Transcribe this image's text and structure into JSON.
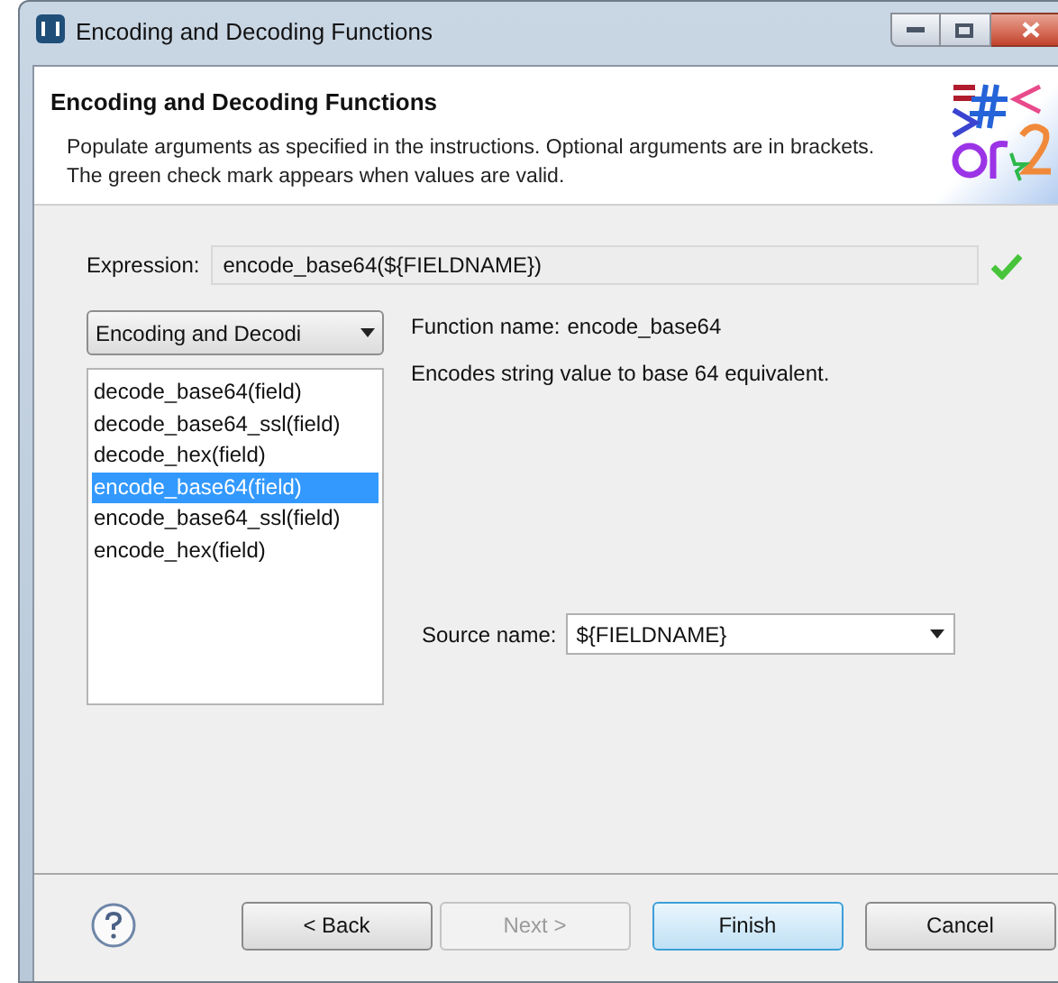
{
  "window": {
    "title": "Encoding and Decoding Functions",
    "controls": [
      {
        "kind": "minimize"
      },
      {
        "kind": "maximize"
      },
      {
        "kind": "close"
      }
    ]
  },
  "header": {
    "title": "Encoding and Decoding Functions",
    "description": "Populate arguments as specified in the instructions. Optional arguments are in brackets. The green check mark appears when values are valid."
  },
  "expression": {
    "label": "Expression:",
    "value": "encode_base64(${FIELDNAME})",
    "valid": true
  },
  "category": {
    "value": "Encoding and Decodi"
  },
  "functions": [
    {
      "label": "decode_base64(field)",
      "selected": false
    },
    {
      "label": "decode_base64_ssl(field)",
      "selected": false
    },
    {
      "label": "decode_hex(field)",
      "selected": false
    },
    {
      "label": "encode_base64(field)",
      "selected": true
    },
    {
      "label": "encode_base64_ssl(field)",
      "selected": false
    },
    {
      "label": "encode_hex(field)",
      "selected": false
    }
  ],
  "function_name": {
    "label": "Function name:",
    "value": "encode_base64"
  },
  "function_description": "Encodes string value to base 64 equivalent.",
  "source_name": {
    "label": "Source name:",
    "value": "${FIELDNAME}"
  },
  "buttons": [
    {
      "label": "< Back",
      "disabled": false,
      "default": false
    },
    {
      "label": "Next >",
      "disabled": true,
      "default": false
    },
    {
      "label": "Finish",
      "disabled": false,
      "default": true
    },
    {
      "label": "Cancel",
      "disabled": false,
      "default": false
    }
  ]
}
